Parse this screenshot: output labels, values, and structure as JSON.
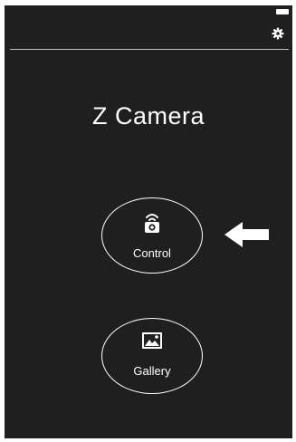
{
  "app": {
    "title": "Z Camera"
  },
  "toolbar": {
    "settings_icon": "gear-icon",
    "battery_icon": "battery-icon"
  },
  "menu": {
    "control": {
      "label": "Control",
      "icon": "remote-camera-icon"
    },
    "gallery": {
      "label": "Gallery",
      "icon": "image-icon"
    }
  },
  "annotation": {
    "icon": "left-arrow-icon",
    "color": "#ffffff"
  },
  "colors": {
    "background": "#1f1f1f",
    "foreground": "#ffffff",
    "divider": "#bdbdbd"
  }
}
